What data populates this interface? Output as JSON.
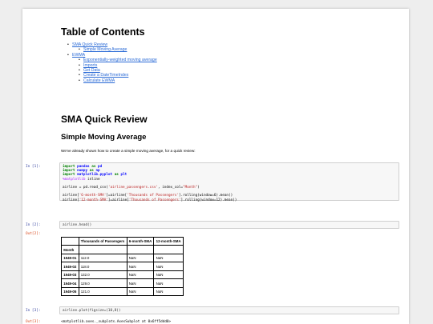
{
  "toc": {
    "title": "Table of Contents",
    "items": [
      {
        "label": "SMA Quick Review",
        "children": [
          "Simple Moving Average"
        ]
      },
      {
        "label": "EWMA",
        "children": [
          "Exponentially-weighted moving average",
          "Imports",
          "Get Data",
          "Create a DateTimeIndex",
          "Calculate EWMA"
        ]
      }
    ]
  },
  "section": {
    "title": "SMA Quick Review",
    "subtitle": "Simple Moving Average",
    "paragraph": "We've already shown how to create a simple moving average, for a quick review:"
  },
  "cells": {
    "c1": {
      "prompt": "In [1]:",
      "lines": [
        "import pandas as pd",
        "import numpy as np",
        "import matplotlib.pyplot as plt",
        "%matplotlib inline",
        "",
        "airline = pd.read_csv('airline_passengers.csv', index_col=\"Month\")",
        "",
        "airline['6-month-SMA']=airline['Thousands of Passengers'].rolling(window=6).mean()",
        "airline['12-month-SMA']=airline['Thousands of Passengers'].rolling(window=12).mean()"
      ]
    },
    "c2": {
      "prompt": "In [2]:",
      "code": "airline.head()",
      "out_prompt": "Out[2]:"
    },
    "c3": {
      "prompt": "In [3]:",
      "code": "airline.plot(figsize=(10,8))",
      "out_prompt": "Out[3]:",
      "out_text": "<matplotlib.axes._subplots.AxesSubplot at 0x6ff5ddd0>"
    }
  },
  "dataframe": {
    "columns": [
      "Thousands of Passengers",
      "6-month-SMA",
      "12-month-SMA"
    ],
    "index_name": "Month",
    "rows": [
      {
        "idx": "1949-01",
        "vals": [
          "112.0",
          "NaN",
          "NaN"
        ]
      },
      {
        "idx": "1949-02",
        "vals": [
          "118.0",
          "NaN",
          "NaN"
        ]
      },
      {
        "idx": "1949-03",
        "vals": [
          "132.0",
          "NaN",
          "NaN"
        ]
      },
      {
        "idx": "1949-04",
        "vals": [
          "129.0",
          "NaN",
          "NaN"
        ]
      },
      {
        "idx": "1949-05",
        "vals": [
          "121.0",
          "NaN",
          "NaN"
        ]
      }
    ]
  },
  "colors": {
    "link": "#2a6ad6",
    "in_prompt": "#303f9f",
    "out_prompt": "#d84315"
  }
}
